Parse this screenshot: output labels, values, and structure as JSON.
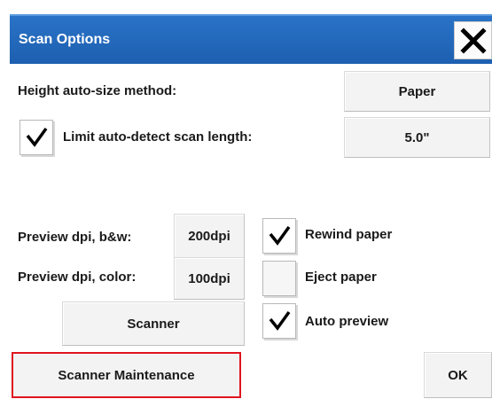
{
  "dialog": {
    "title": "Scan Options",
    "height_method_label": "Height auto-size method:",
    "height_method_value": "Paper",
    "limit_label": "Limit auto-detect scan length:",
    "limit_checked": true,
    "limit_value": "5.0\"",
    "preview_bw_label": "Preview dpi, b&w:",
    "preview_bw_value": "200dpi",
    "preview_color_label": "Preview dpi, color:",
    "preview_color_value": "100dpi",
    "scanner_button": "Scanner",
    "rewind_label": "Rewind paper",
    "rewind_checked": true,
    "eject_label": "Eject paper",
    "eject_checked": false,
    "auto_preview_label": "Auto preview",
    "auto_preview_checked": true,
    "maintenance_button": "Scanner Maintenance",
    "ok_button": "OK"
  },
  "colors": {
    "titlebar": "#1d5fb0",
    "highlight_border": "#e0141e"
  },
  "icons": {
    "close": "close-icon",
    "check": "checkmark-icon"
  }
}
